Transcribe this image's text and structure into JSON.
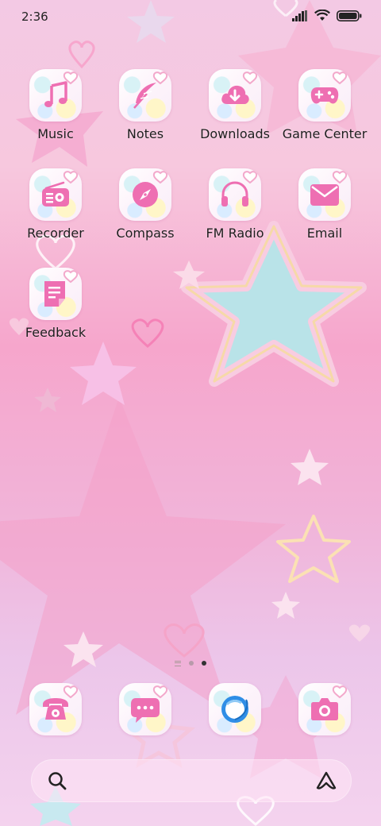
{
  "status_bar": {
    "time": "2:36"
  },
  "home_rows": [
    [
      {
        "label": "Music",
        "icon": "music-note-icon"
      },
      {
        "label": "Notes",
        "icon": "feather-quill-icon"
      },
      {
        "label": "Downloads",
        "icon": "cloud-download-icon"
      },
      {
        "label": "Game Center",
        "icon": "gamepad-icon"
      }
    ],
    [
      {
        "label": "Recorder",
        "icon": "radio-icon"
      },
      {
        "label": "Compass",
        "icon": "compass-icon"
      },
      {
        "label": "FM Radio",
        "icon": "headphones-icon"
      },
      {
        "label": "Email",
        "icon": "envelope-icon"
      }
    ],
    [
      {
        "label": "Feedback",
        "icon": "feedback-document-icon"
      }
    ]
  ],
  "dock": [
    {
      "name": "phone",
      "icon": "telephone-icon"
    },
    {
      "name": "messages",
      "icon": "chat-bubble-icon"
    },
    {
      "name": "browser",
      "icon": "browser-planet-icon"
    },
    {
      "name": "camera",
      "icon": "camera-icon"
    }
  ],
  "page_indicator": {
    "pages": 2,
    "current": 2
  },
  "colors": {
    "icon_pink": "#ee6fb2",
    "browser_blue": "#2f8ee6"
  }
}
